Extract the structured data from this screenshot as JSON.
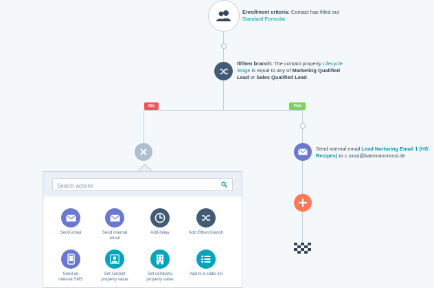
{
  "enrollment": {
    "label": "Enrollment criteria:",
    "text": " Contact has filled out ",
    "link": "Standard Formular",
    "end": "."
  },
  "branch": {
    "label": "If/then branch:",
    "text1": " The contact property ",
    "link": "Lifecycle Stage",
    "text2": " is equal to any of ",
    "value1": "Marketing Qualified Lead",
    "text3": " or ",
    "value2": "Sales Qualified Lead",
    "end": "."
  },
  "tags": {
    "no": "No",
    "yes": "Yes"
  },
  "email_step": {
    "text": "Send internal email ",
    "link": "Lead Nurturing Email 1 (HS Recipes)",
    "text2": " to c.rossi@kammannrossi.de"
  },
  "panel": {
    "search_placeholder": "Search actions",
    "actions": [
      {
        "label": "Send email",
        "color": "#6a78d1",
        "icon": "envelope-icon"
      },
      {
        "label": "Send internal email",
        "color": "#6a78d1",
        "icon": "envelope-icon"
      },
      {
        "label": "Add delay",
        "color": "#425b76",
        "icon": "clock-icon"
      },
      {
        "label": "Add if/then branch",
        "color": "#425b76",
        "icon": "shuffle-icon"
      },
      {
        "label": "Send an internal SMS",
        "color": "#6a78d1",
        "icon": "phone-icon"
      },
      {
        "label": "Set contact property value",
        "color": "#00a4bd",
        "icon": "person-icon"
      },
      {
        "label": "Set company property value",
        "color": "#00a4bd",
        "icon": "building-icon"
      },
      {
        "label": "Add to a static list",
        "color": "#00a4bd",
        "icon": "list-icon"
      }
    ]
  },
  "colors": {
    "dark_node": "#425b76",
    "email_node": "#6a78d1",
    "add_node": "#ff7a59",
    "teal": "#00a4bd",
    "no_tag": "#f2545b",
    "yes_tag": "#7fd15e"
  }
}
